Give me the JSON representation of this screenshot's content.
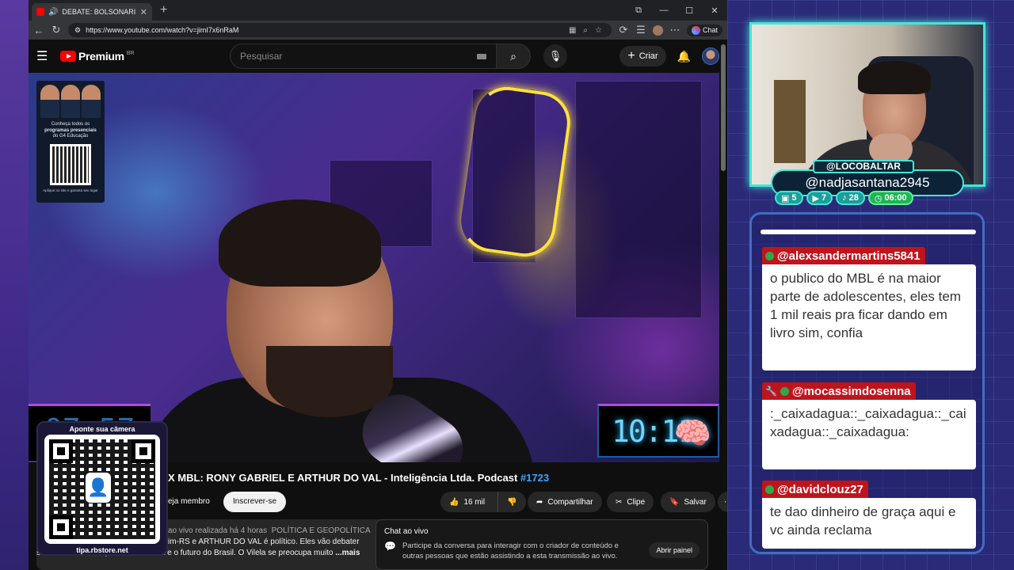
{
  "browser": {
    "tab_title": "DEBATE: BOLSONARISTA X MI",
    "url": "https://www.youtube.com/watch?v=jimI7x6nRaM",
    "chat_label": "Chat"
  },
  "youtube": {
    "brand": "Premium",
    "region": "BR",
    "search_placeholder": "Pesquisar",
    "create_label": "Criar"
  },
  "video": {
    "ad": {
      "line1": "Conheça todos os",
      "line2": "programas presenciais",
      "line3": "do G4 Educação",
      "footer": "Aponte sua câmera"
    },
    "clock_left": "07:57",
    "clock_right": "10:11",
    "title_main": "X MBL: RONY GABRIEL E ARTHUR DO VAL - Inteligência Ltda. Podcast ",
    "title_tag": "#1723",
    "member_label": "eja membro",
    "subscribe_label": "Inscrever-se",
    "likes": "16 mil",
    "share_label": "Compartilhar",
    "clip_label": "Clipe",
    "save_label": "Salvar"
  },
  "description": {
    "meta": "ao vivo realizada há 4 horas",
    "category": "POLÍTICA E GEOPOLÍTICA",
    "line2": "im-RS e ARTHUR DO VAL é político. Eles vão debater",
    "line3": "sobre Bolsonaro, a política de direita e o futuro do Brasil. O Vilela se preocupa muito",
    "more": "...mais"
  },
  "livechat": {
    "title": "Chat ao vivo",
    "text": "Participe da conversa para interagir com o criador de conteúdo e outras pessoas que estão assistindo a esta transmissão ao vivo.",
    "open_label": "Abrir painel"
  },
  "qr_overlay": {
    "top_text": "Aponte sua câmera",
    "bottom_text": "tipa.rbstore.net"
  },
  "streamer": {
    "handle": "@LOCOBALTAR",
    "sub_handle": "@nadjasantana2945",
    "stats": [
      {
        "icon": "chat-icon",
        "value": "5"
      },
      {
        "icon": "youtube-icon",
        "value": "7"
      },
      {
        "icon": "tiktok-icon",
        "value": "28"
      },
      {
        "icon": "clock-icon",
        "value": "06:00"
      }
    ]
  },
  "chat": {
    "messages": [
      {
        "user": "@alexsandermartins5841",
        "text": "o publico do MBL é na maior parte de adolescentes, eles tem 1 mil reais pra ficar dando em livro sim, confia"
      },
      {
        "user": "@mocassimdosenna",
        "text": ":_caixadagua::_caixadagua::_caixadagua::_caixadagua:"
      },
      {
        "user": "@davidclouz27",
        "text": "te dao dinheiro de graça aqui e vc ainda reclama"
      }
    ]
  }
}
